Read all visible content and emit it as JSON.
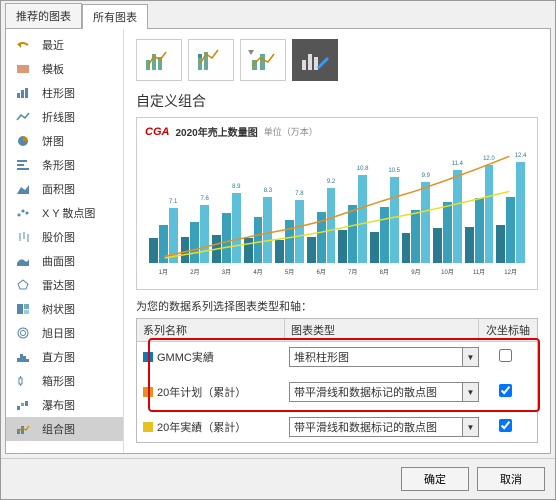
{
  "tabs": {
    "recommended": "推荐的图表",
    "all": "所有图表"
  },
  "sidebar": {
    "items": [
      {
        "label": "最近",
        "icon": "recent"
      },
      {
        "label": "模板",
        "icon": "template"
      },
      {
        "label": "柱形图",
        "icon": "column"
      },
      {
        "label": "折线图",
        "icon": "line"
      },
      {
        "label": "饼图",
        "icon": "pie"
      },
      {
        "label": "条形图",
        "icon": "bar"
      },
      {
        "label": "面积图",
        "icon": "area"
      },
      {
        "label": "X Y 散点图",
        "icon": "scatter"
      },
      {
        "label": "股价图",
        "icon": "stock"
      },
      {
        "label": "曲面图",
        "icon": "surface"
      },
      {
        "label": "雷达图",
        "icon": "radar"
      },
      {
        "label": "树状图",
        "icon": "treemap"
      },
      {
        "label": "旭日图",
        "icon": "sunburst"
      },
      {
        "label": "直方图",
        "icon": "histogram"
      },
      {
        "label": "箱形图",
        "icon": "box"
      },
      {
        "label": "瀑布图",
        "icon": "waterfall"
      },
      {
        "label": "组合图",
        "icon": "combo"
      }
    ],
    "selected": 16
  },
  "section_title": "自定义组合",
  "preview": {
    "logo": "CGA",
    "title": "2020年売上数量图",
    "unit": "单位（万本）"
  },
  "chart_data": {
    "type": "combo",
    "categories": [
      "1月",
      "2月",
      "3月",
      "4月",
      "5月",
      "6月",
      "7月",
      "8月",
      "9月",
      "10月",
      "11月",
      "12月"
    ],
    "series": [
      {
        "name": "GMMC実績",
        "type": "stacked-bar",
        "values": [
          [
            1.5,
            2.3,
            3.3
          ],
          [
            1.6,
            2.5,
            3.5
          ],
          [
            1.7,
            3.0,
            4.2
          ],
          [
            1.5,
            2.8,
            4.0
          ],
          [
            1.4,
            2.6,
            3.8
          ],
          [
            1.6,
            3.1,
            4.5
          ],
          [
            2.0,
            3.5,
            5.3
          ],
          [
            1.9,
            3.4,
            5.2
          ],
          [
            1.8,
            3.2,
            4.9
          ],
          [
            2.1,
            3.7,
            5.6
          ],
          [
            2.2,
            3.9,
            5.9
          ],
          [
            2.3,
            4.0,
            6.1
          ]
        ]
      },
      {
        "name": "20年计划（累計）",
        "type": "line",
        "values": [
          2.0,
          4.1,
          6.5,
          8.5,
          10.3,
          12.6,
          15.8,
          18.9,
          21.7,
          25.0,
          28.5,
          32.2
        ]
      },
      {
        "name": "20年実績（累計）",
        "type": "line",
        "values": [
          1.5,
          3.1,
          4.8,
          6.3,
          7.7,
          9.3,
          11.3,
          13.2,
          15.0,
          17.1,
          19.3,
          21.6
        ]
      }
    ],
    "ylim": [
      0,
      7
    ],
    "y2lim": [
      0,
      35
    ]
  },
  "grid": {
    "label": "为您的数据系列选择图表类型和轴：",
    "headers": {
      "name": "系列名称",
      "type": "图表类型",
      "axis": "次坐标轴"
    },
    "rows": [
      {
        "name": "GMMC実績",
        "type": "堆积柱形图",
        "axis": false
      },
      {
        "name": "20年计划（累計）",
        "type": "带平滑线和数据标记的散点图",
        "axis": true
      },
      {
        "name": "20年実績（累計）",
        "type": "带平滑线和数据标记的散点图",
        "axis": true
      }
    ]
  },
  "footer": {
    "ok": "确定",
    "cancel": "取消"
  }
}
